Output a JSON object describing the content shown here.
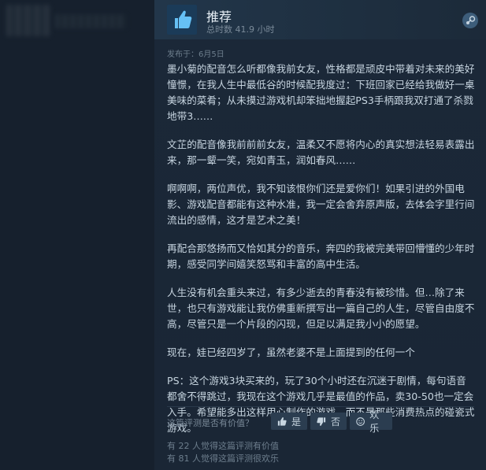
{
  "header": {
    "recommendation": "推荐",
    "hours": "总时数 41.9 小时"
  },
  "review": {
    "posted": "发布于：6月5日",
    "paragraphs": [
      "墨小菊的配音怎么听都像我前女友，性格都是顽皮中带着对未来的美好憧憬，在我人生中最低谷的时候配我度过：下班回家已经给我做好一桌美味的菜肴；从未摸过游戏机却笨拙地握起PS3手柄跟我双打通了杀戮地带3……",
      "文芷的配音像我前前前女友，温柔又不愿将内心的真实想法轻易表露出来，那一颦一笑，宛如青玉，润如春风……",
      "啊啊啊，两位声优，我不知该恨你们还是爱你们！如果引进的外国电影、游戏配音都能有这种水准，我一定会舍弃原声版，去体会字里行间流出的感情，这才是艺术之美！",
      "再配合那悠扬而又恰如其分的音乐，奔四的我被完美带回懵懂的少年时期，感受同学间嬉笑怒骂和丰富的高中生活。",
      "人生没有机会重头来过，有多少逝去的青春没有被珍惜。但…除了来世，也只有游戏能让我仿佛重新撰写出一篇自己的人生，尽管自由度不高，尽管只是一个片段的闪现，但足以满足我小小的愿望。",
      "现在，娃已经四岁了，虽然老婆不是上面提到的任何一个",
      "PS：这个游戏3块买来的，玩了30个小时还在沉迷于剧情，每句语音都舍不得跳过，我现在这个游戏几乎是最值的作品，卖30-50也一定会入手。希望能多出这样用心制作的游戏，而不是那些消费热点的碰瓷式游戏。"
    ]
  },
  "feedback": {
    "question": "这篇评测是否有价值？",
    "yes": "是",
    "no": "否",
    "funny": "欢乐",
    "helpful_count": "有 22 人觉得这篇评测有价值",
    "funny_count": "有 81 人觉得这篇评测很欢乐"
  },
  "colors": {
    "background": "#1b2838",
    "accent": "#66c0f4",
    "text": "#c7d5e0"
  },
  "icons": {
    "recommend": "thumbs-up-icon",
    "steam": "steam-icon",
    "yes": "thumbs-up-icon",
    "no": "thumbs-down-icon",
    "funny": "smile-icon"
  }
}
